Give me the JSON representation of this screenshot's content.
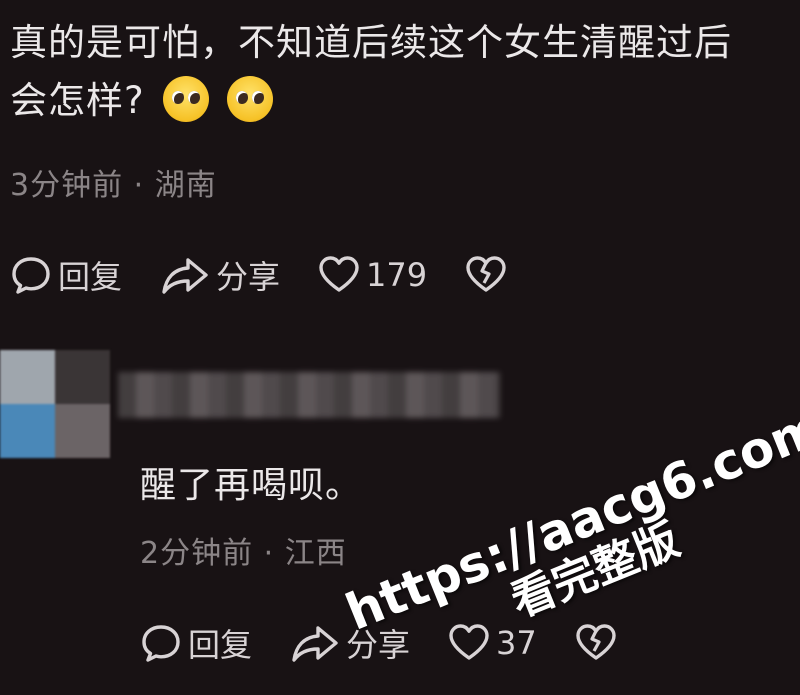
{
  "comment": {
    "text_line1": "真的是可怕，不知道后续这个女生清醒过后",
    "text_line2": "会怎样?",
    "emojis": [
      "pleading-face-icon",
      "pleading-face-icon"
    ],
    "meta": "3分钟前 · 湖南",
    "actions": {
      "reply": "回复",
      "share": "分享",
      "likes": "179"
    }
  },
  "reply": {
    "text": "醒了再喝呗。",
    "meta": "2分钟前 · 江西",
    "actions": {
      "reply": "回复",
      "share": "分享",
      "likes": "37"
    }
  },
  "watermark": {
    "url": "https://aacg6.com",
    "subtitle": "看完整版"
  }
}
